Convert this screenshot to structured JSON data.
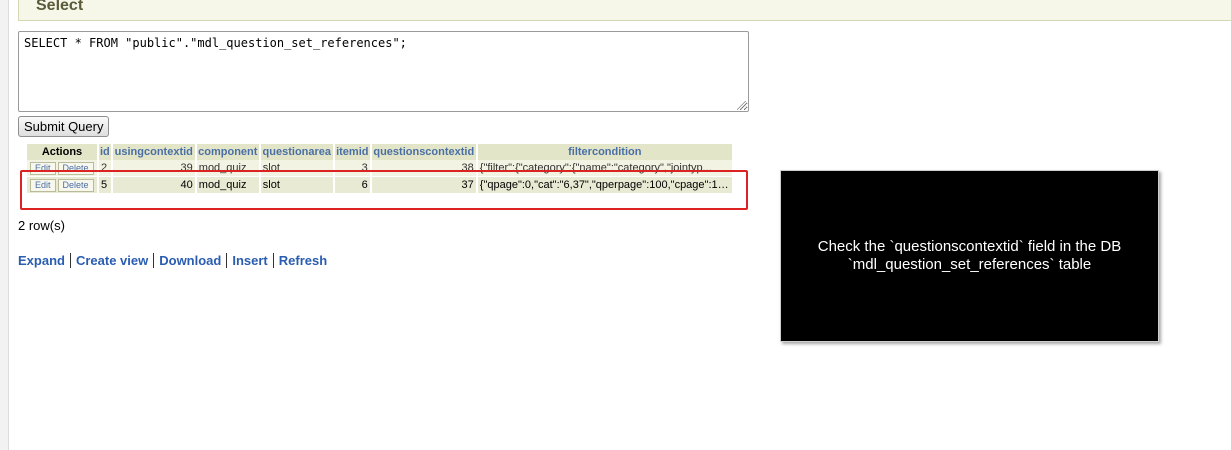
{
  "section": {
    "title": "Select"
  },
  "query": {
    "text": "SELECT * FROM \"public\".\"mdl_question_set_references\";"
  },
  "submit": {
    "label": "Submit Query"
  },
  "table": {
    "headers": [
      "Actions",
      "id",
      "usingcontextid",
      "component",
      "questionarea",
      "itemid",
      "questionscontextid",
      "filtercondition"
    ],
    "rows": [
      {
        "edit": "Edit",
        "delete": "Delete",
        "id": "2",
        "usingcontextid": "39",
        "component": "mod_quiz",
        "questionarea": "slot",
        "itemid": "3",
        "questionscontextid": "38",
        "filtercondition": "{\"filter\":{\"category\":{\"name\":\"category\",\"jointyp..."
      },
      {
        "edit": "Edit",
        "delete": "Delete",
        "id": "5",
        "usingcontextid": "40",
        "component": "mod_quiz",
        "questionarea": "slot",
        "itemid": "6",
        "questionscontextid": "37",
        "filtercondition": "{\"qpage\":0,\"cat\":\"6,37\",\"qperpage\":100,\"cpage\":1,..."
      }
    ]
  },
  "rowcount": "2 row(s)",
  "links": [
    "Expand",
    "Create view",
    "Download",
    "Insert",
    "Refresh"
  ],
  "tip": {
    "text": "Check the `questionscontextid` field in the DB `mdl_question_set_references` table"
  },
  "colors": {
    "header_bg": "#e3e5c8",
    "link": "#2a5db0",
    "highlight": "#dd2222"
  }
}
